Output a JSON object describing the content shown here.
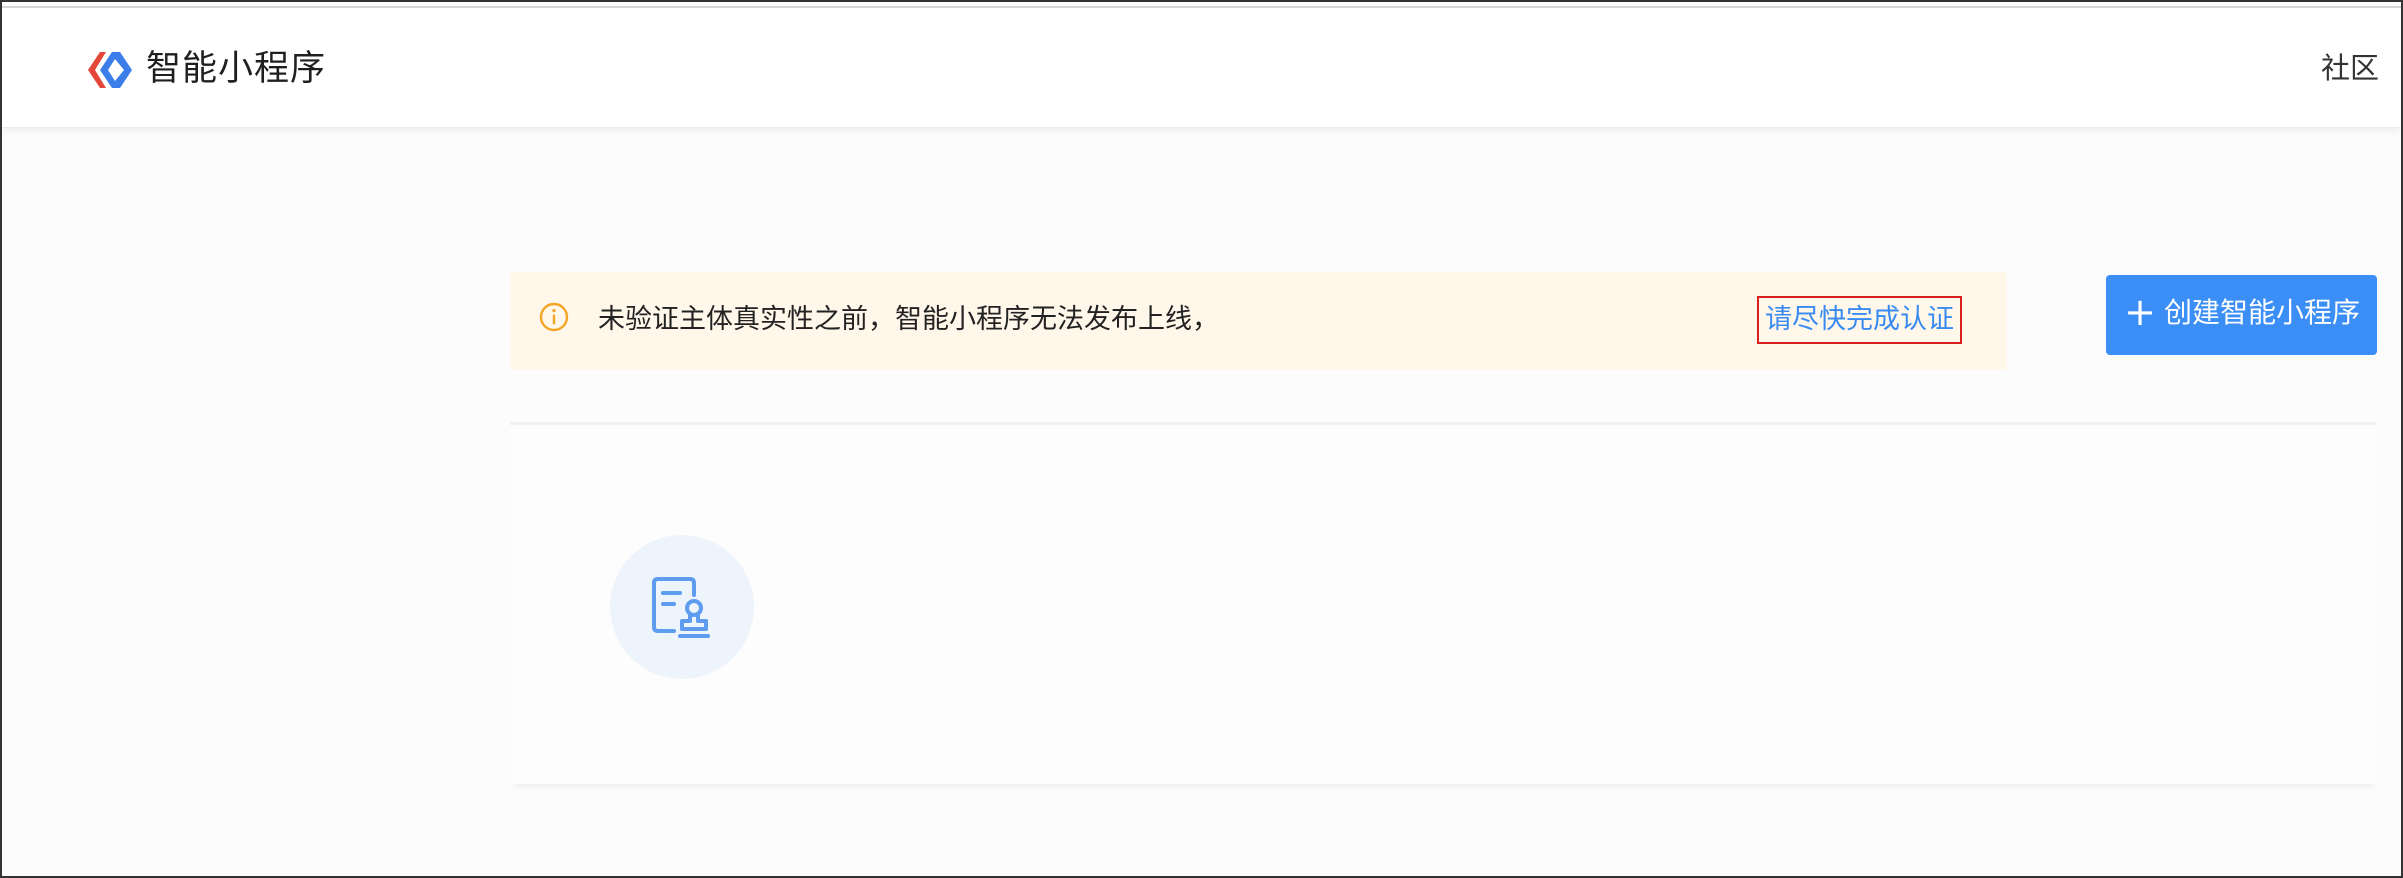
{
  "header": {
    "brand_title": "智能小程序",
    "community_link": "社区"
  },
  "alert": {
    "message": "未验证主体真实性之前，智能小程序无法发布上线，",
    "link_text": "请尽快完成认证",
    "icon": "info-circle-icon"
  },
  "actions": {
    "create_icon": "+",
    "create_label": "创建智能小程序"
  },
  "card": {
    "icon": "certificate-stamp-icon"
  },
  "colors": {
    "primary": "#3a8ef5",
    "link": "#3a8bf0",
    "alert_bg": "#fff7ea",
    "alert_icon": "#f5a524",
    "highlight_border": "#d81e1e",
    "logo_red": "#e5463a",
    "logo_blue": "#3b7de9"
  }
}
